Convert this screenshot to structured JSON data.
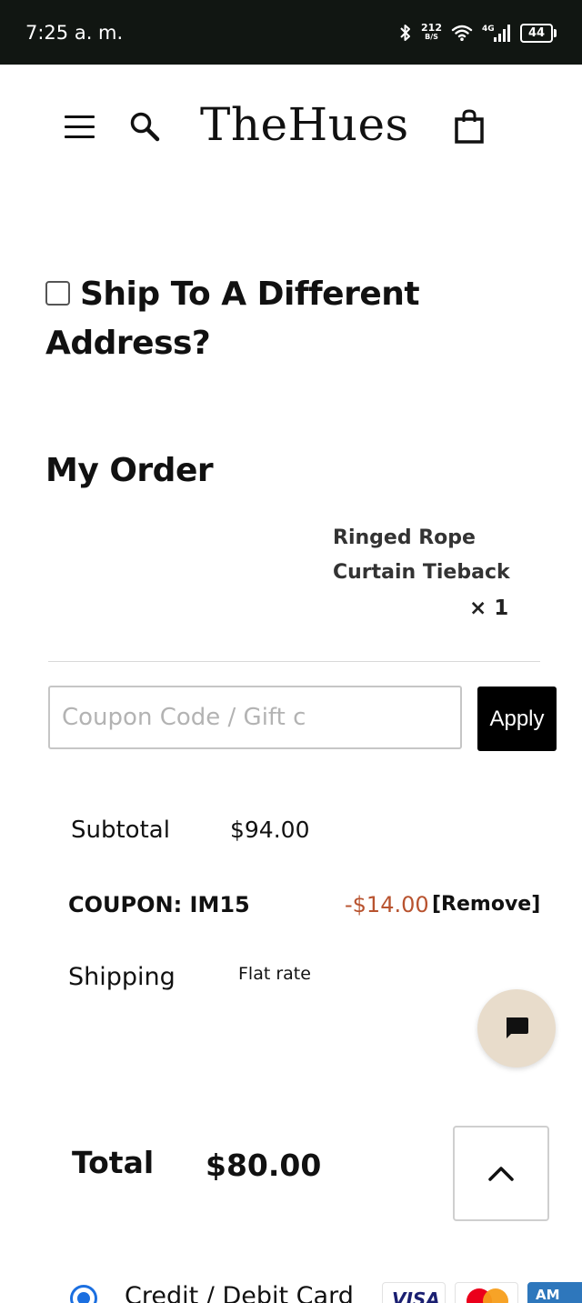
{
  "status_bar": {
    "time": "7:25 a. m.",
    "net_speed_value": "212",
    "net_speed_unit": "B/S",
    "network_type": "4G",
    "battery": "44"
  },
  "header": {
    "brand": "TheHues",
    "icons": [
      "menu-icon",
      "search-icon",
      "shopping-bag-icon"
    ]
  },
  "shipping": {
    "different_address_label": "Ship To A Different Address?",
    "checked": false
  },
  "order": {
    "title": "My Order",
    "items": [
      {
        "name": "Ringed Rope Curtain Tieback",
        "quantity": "× 1"
      }
    ]
  },
  "coupon": {
    "placeholder": "Coupon Code / Gift c",
    "value": "",
    "apply_label": "Apply"
  },
  "totals": {
    "subtotal_label": "Subtotal",
    "subtotal_value": "$94.00",
    "coupon_label": "COUPON: IM15",
    "coupon_amount": "-$14.00",
    "coupon_remove": "[Remove]",
    "shipping_label": "Shipping",
    "shipping_value": "Flat rate",
    "total_label": "Total",
    "total_value": "$80.00"
  },
  "payment": {
    "method_label": "Credit / Debit Card",
    "selected": true,
    "card_logos": [
      {
        "name": "visa",
        "text": "VISA"
      },
      {
        "name": "mastercard",
        "text": ""
      },
      {
        "name": "amex",
        "text": "AM"
      }
    ]
  },
  "colors": {
    "status_bar_bg": "#111612",
    "accent_button": "#000000",
    "discount_text": "#b8532f",
    "chat_button_bg": "#e8dccb",
    "radio_blue": "#1b6fe0"
  }
}
